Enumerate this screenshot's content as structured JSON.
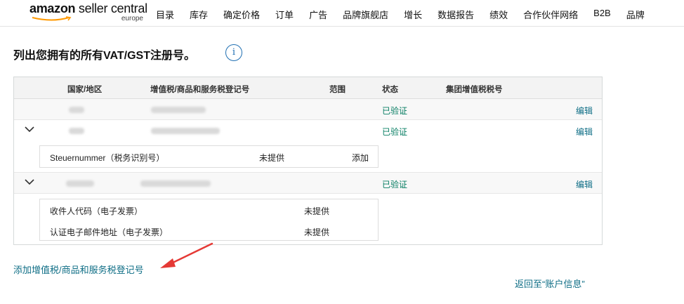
{
  "logo": {
    "brand": "amazon",
    "product": "seller central",
    "region": "europe"
  },
  "nav": [
    "目录",
    "库存",
    "确定价格",
    "订单",
    "广告",
    "品牌旗舰店",
    "增长",
    "数据报告",
    "绩效",
    "合作伙伴网络",
    "B2B",
    "品牌"
  ],
  "page": {
    "title": "列出您拥有的所有VAT/GST注册号。",
    "info_glyph": "i"
  },
  "table": {
    "headers": {
      "country": "国家/地区",
      "vat_number": "增值税/商品和服务税登记号",
      "scope": "范围",
      "status": "状态",
      "group_vat": "集团增值税税号"
    },
    "rows": [
      {
        "status": "已验证",
        "action": "编辑"
      },
      {
        "status": "已验证",
        "action": "编辑",
        "details": [
          {
            "label": "Steuernummer（税务识别号）",
            "value": "未提供",
            "action": "添加"
          }
        ]
      },
      {
        "status": "已验证",
        "action": "编辑",
        "details": [
          {
            "label": "收件人代码（电子发票）",
            "value": "未提供"
          },
          {
            "label": "认证电子邮件地址（电子发票）",
            "value": "未提供"
          }
        ]
      }
    ]
  },
  "footer": {
    "add_link": "添加增值税/商品和服务税登记号",
    "back_link": "返回至“账户信息”"
  },
  "colors": {
    "link": "#0f6e86",
    "verified": "#067d62",
    "arrow": "#e53935",
    "info": "#1f6fb2"
  }
}
